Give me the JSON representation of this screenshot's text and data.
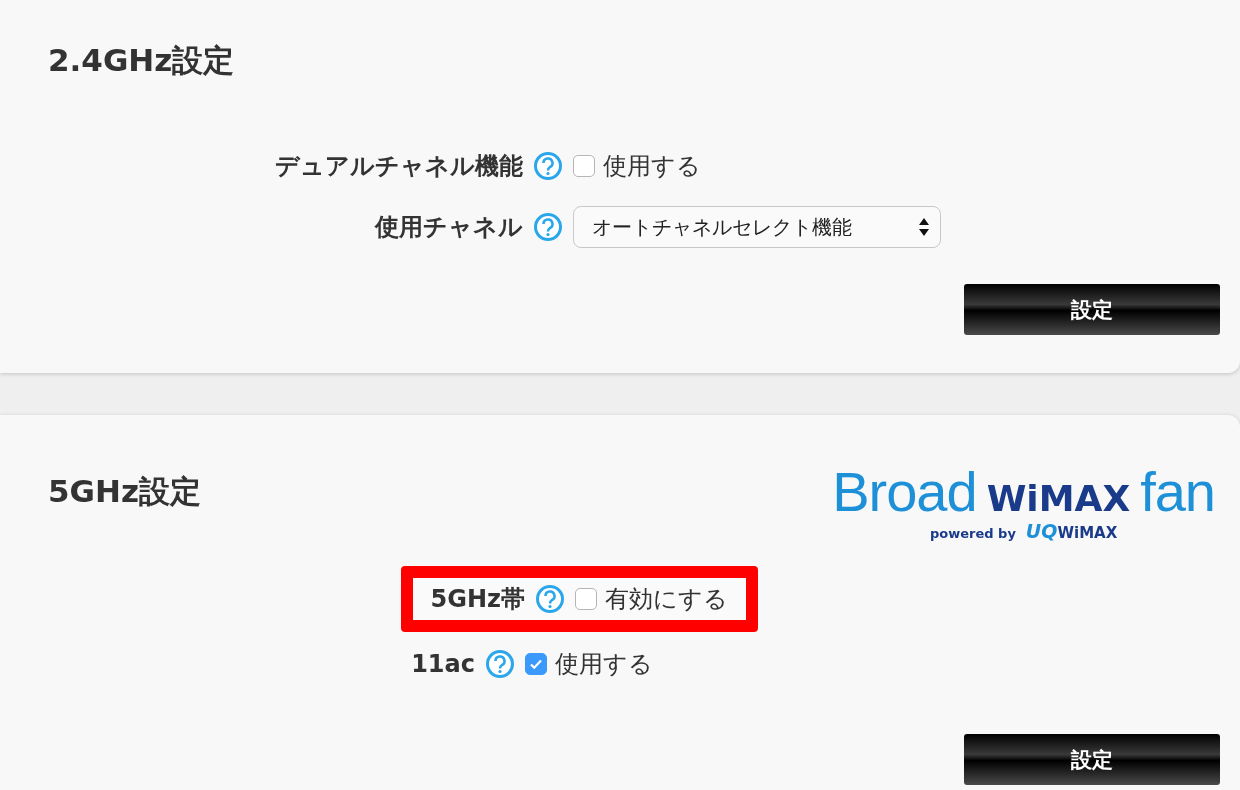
{
  "sections": [
    {
      "title": "2.4GHz設定",
      "rows": [
        {
          "kind": "checkbox",
          "label": "デュアルチャネル機能",
          "option": "使用する",
          "checked": false,
          "highlighted": false
        },
        {
          "kind": "select",
          "label": "使用チャネル",
          "value": "オートチャネルセレクト機能",
          "highlighted": false
        }
      ],
      "button": "設定"
    },
    {
      "title": "5GHz設定",
      "logo": {
        "brand": "Broad",
        "product": "WiMAX",
        "suffix": "fan",
        "powered": "powered by",
        "partner_a": "UQ",
        "partner_b": "WiMAX"
      },
      "rows": [
        {
          "kind": "checkbox",
          "label": "5GHz帯",
          "option": "有効にする",
          "checked": false,
          "highlighted": true
        },
        {
          "kind": "checkbox",
          "label": "11ac",
          "option": "使用する",
          "checked": true,
          "highlighted": false
        }
      ],
      "button": "設定"
    }
  ]
}
